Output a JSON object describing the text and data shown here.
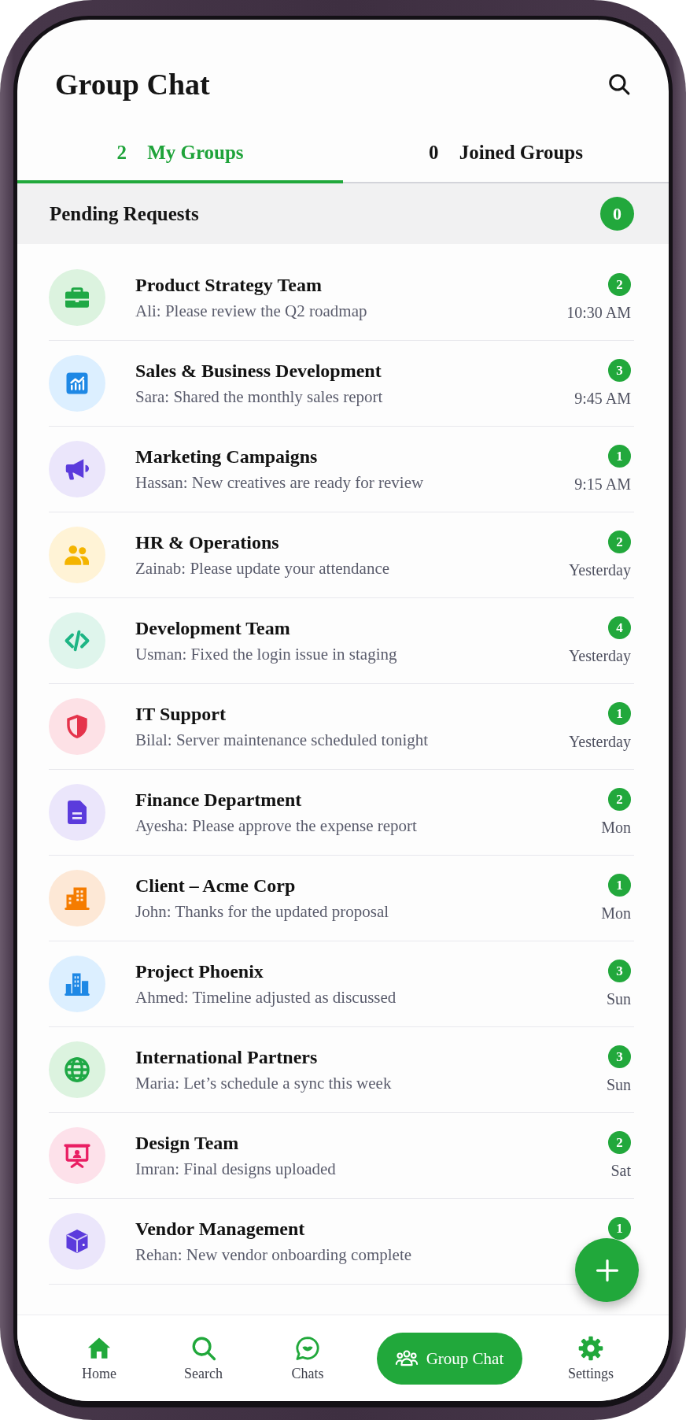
{
  "header": {
    "title": "Group Chat"
  },
  "tabs": [
    {
      "count": "2",
      "label": "My Groups",
      "selected": true
    },
    {
      "count": "0",
      "label": "Joined Groups",
      "selected": false
    }
  ],
  "pending_requests": {
    "label": "Pending Requests",
    "count": "0"
  },
  "groups": [
    {
      "name": "Product Strategy Team",
      "last_message": "Ali: Please review the Q2 roadmap",
      "unread": "2",
      "time": "10:30 AM"
    },
    {
      "name": "Sales & Business Development",
      "last_message": "Sara: Shared the monthly sales report",
      "unread": "3",
      "time": "9:45 AM"
    },
    {
      "name": "Marketing Campaigns",
      "last_message": "Hassan: New creatives are ready for review",
      "unread": "1",
      "time": "9:15 AM"
    },
    {
      "name": "HR & Operations",
      "last_message": "Zainab: Please update your attendance",
      "unread": "2",
      "time": "Yesterday"
    },
    {
      "name": "Development Team",
      "last_message": "Usman: Fixed the login issue in staging",
      "unread": "4",
      "time": "Yesterday"
    },
    {
      "name": "IT Support",
      "last_message": "Bilal: Server maintenance scheduled tonight",
      "unread": "1",
      "time": "Yesterday"
    },
    {
      "name": "Finance Department",
      "last_message": "Ayesha: Please approve the expense report",
      "unread": "2",
      "time": "Mon"
    },
    {
      "name": "Client – Acme Corp",
      "last_message": "John: Thanks for the updated proposal",
      "unread": "1",
      "time": "Mon"
    },
    {
      "name": "Project Phoenix",
      "last_message": "Ahmed: Timeline adjusted as discussed",
      "unread": "3",
      "time": "Sun"
    },
    {
      "name": "International Partners",
      "last_message": "Maria: Let’s schedule a sync this week",
      "unread": "3",
      "time": "Sun"
    },
    {
      "name": "Design Team",
      "last_message": "Imran: Final designs uploaded",
      "unread": "2",
      "time": "Sat"
    },
    {
      "name": "Vendor Management",
      "last_message": "Rehan: New vendor onboarding complete",
      "unread": "1"
    }
  ],
  "bottom_nav": [
    {
      "label": "Home",
      "selected": false
    },
    {
      "label": "Search",
      "selected": false
    },
    {
      "label": "Chats",
      "selected": false
    },
    {
      "label": "Group Chat",
      "selected": true
    },
    {
      "label": "Settings",
      "selected": false
    }
  ]
}
